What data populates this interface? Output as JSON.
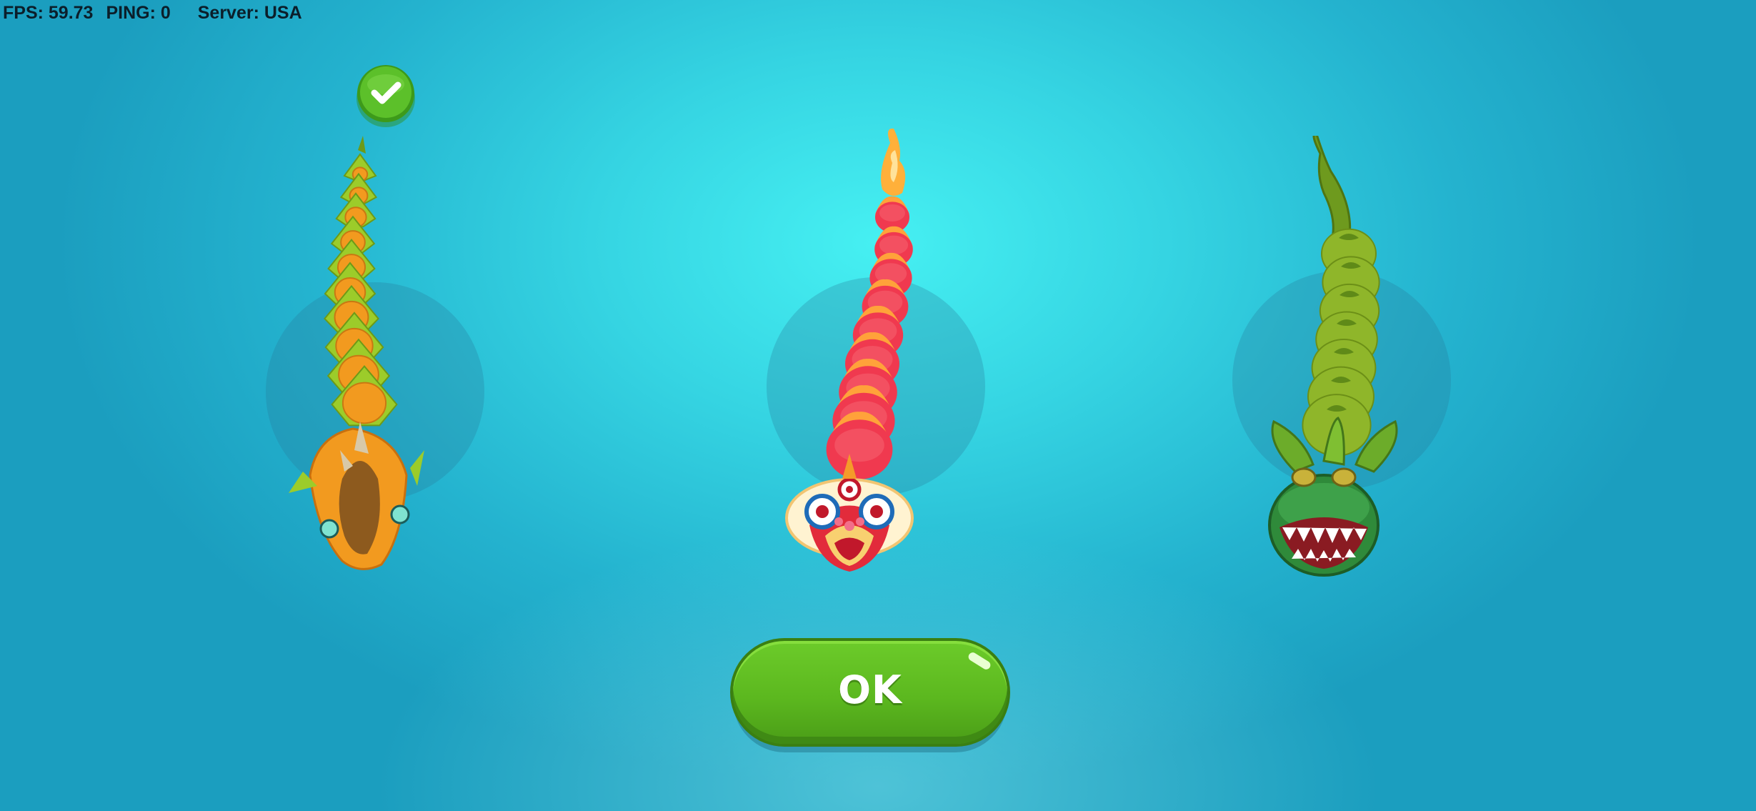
{
  "hud": {
    "fps": "FPS: 59.73",
    "ping": "PING: 0",
    "server": "Server: USA"
  },
  "skins": [
    {
      "name": "dragon-skin",
      "selected": true
    },
    {
      "name": "lion-dance-skin",
      "selected": false
    },
    {
      "name": "piranha-plant-skin",
      "selected": false
    }
  ],
  "ok_button": {
    "label": "OK"
  },
  "colors": {
    "background": "#35d4e2",
    "button_green": "#5cb81f",
    "checkmark_green": "#4fb320"
  }
}
